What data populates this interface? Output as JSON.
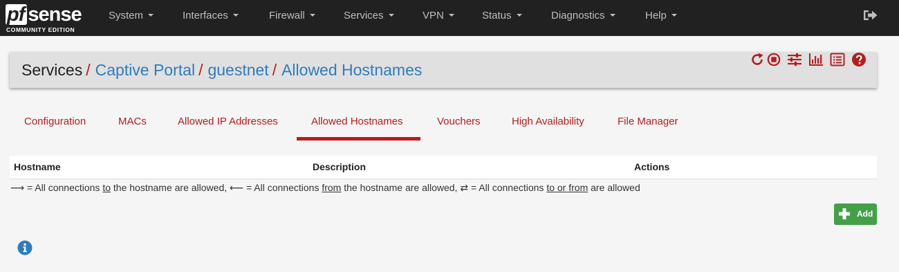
{
  "brand": {
    "logo_pf": "pf",
    "logo_sense": "sense",
    "logo_edition": "COMMUNITY EDITION"
  },
  "nav": {
    "items": [
      {
        "label": "System"
      },
      {
        "label": "Interfaces"
      },
      {
        "label": "Firewall"
      },
      {
        "label": "Services"
      },
      {
        "label": "VPN"
      },
      {
        "label": "Status"
      },
      {
        "label": "Diagnostics"
      },
      {
        "label": "Help"
      }
    ],
    "logout_icon": "sign-out-icon"
  },
  "breadcrumb": {
    "items": [
      {
        "label": "Services",
        "link": false
      },
      {
        "label": "Captive Portal",
        "link": true
      },
      {
        "label": "guestnet",
        "link": true
      },
      {
        "label": "Allowed Hostnames",
        "link": true
      }
    ],
    "separator": "/",
    "icons": [
      "restart-service-icon",
      "stop-service-icon",
      "related-settings-icon",
      "status-chart-icon",
      "log-list-icon",
      "help-icon"
    ]
  },
  "tabs": {
    "items": [
      {
        "label": "Configuration"
      },
      {
        "label": "MACs"
      },
      {
        "label": "Allowed IP Addresses"
      },
      {
        "label": "Allowed Hostnames",
        "active": true
      },
      {
        "label": "Vouchers"
      },
      {
        "label": "High Availability"
      },
      {
        "label": "File Manager"
      }
    ]
  },
  "table": {
    "columns": [
      "Hostname",
      "Description",
      "Actions"
    ],
    "rows": []
  },
  "legend": {
    "arrow_to": "⟶",
    "text1": " = All connections ",
    "u1": "to",
    "text2": " the hostname are allowed, ",
    "arrow_from": "⟵",
    "text3": " = All connections ",
    "u2": "from",
    "text4": " the hostname are allowed, ",
    "arrow_both": "⇄",
    "text5": " = All connections ",
    "u3": "to or from",
    "text6": " are allowed"
  },
  "actions": {
    "add_label": "Add"
  },
  "colors": {
    "navbar_bg": "#212121",
    "accent_red": "#b71c1c",
    "link_blue": "#2c7cc0",
    "add_green": "#43a047",
    "info_blue": "#2c7cc0"
  }
}
